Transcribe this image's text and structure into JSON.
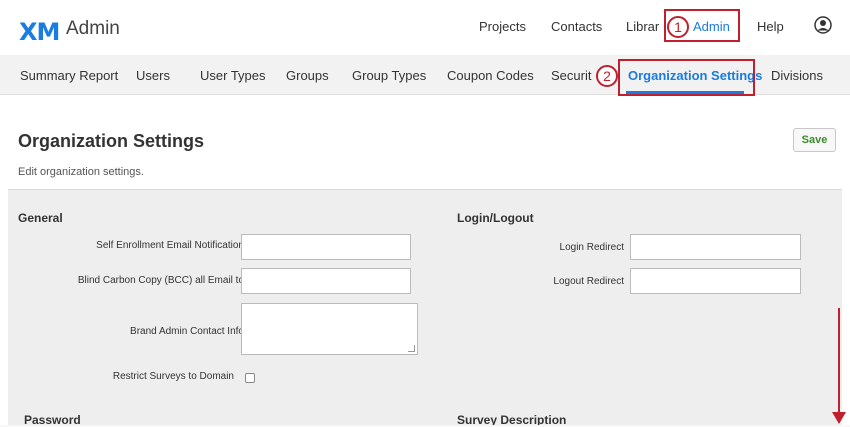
{
  "header": {
    "logo": "XM",
    "app_title": "Admin",
    "nav": {
      "projects": "Projects",
      "contacts": "Contacts",
      "library": "Librar",
      "admin": "Admin",
      "help": "Help"
    }
  },
  "subnav": {
    "summary_report": "Summary Report",
    "users": "Users",
    "user_types": "User Types",
    "groups": "Groups",
    "group_types": "Group Types",
    "coupon_codes": "Coupon Codes",
    "security": "Securit",
    "organization_settings": "Organization Settings",
    "divisions": "Divisions"
  },
  "annotations": {
    "step1": "1",
    "step2": "2"
  },
  "page": {
    "title": "Organization Settings",
    "subtitle": "Edit organization settings.",
    "save_label": "Save"
  },
  "general": {
    "title": "General",
    "self_enrollment_label": "Self Enrollment Email Notification",
    "self_enrollment_value": "",
    "bcc_label": "Blind Carbon Copy (BCC) all Email to",
    "bcc_value": "",
    "brand_admin_label": "Brand Admin Contact Info",
    "brand_admin_value": "",
    "restrict_label": "Restrict Surveys to Domain",
    "restrict_checked": false
  },
  "login_logout": {
    "title": "Login/Logout",
    "login_redirect_label": "Login Redirect",
    "login_redirect_value": "",
    "logout_redirect_label": "Logout Redirect",
    "logout_redirect_value": ""
  },
  "password": {
    "title": "Password"
  },
  "survey_description": {
    "title": "Survey Description"
  },
  "colors": {
    "accent": "#1a7be0",
    "annotation": "#c0202d",
    "save_text": "#3a8c2d",
    "panel_bg": "#eeeeee",
    "subnav_bg": "#f2f2f2"
  },
  "icons": {
    "user": "user-circle-icon",
    "arrow": "down-arrow-icon"
  }
}
